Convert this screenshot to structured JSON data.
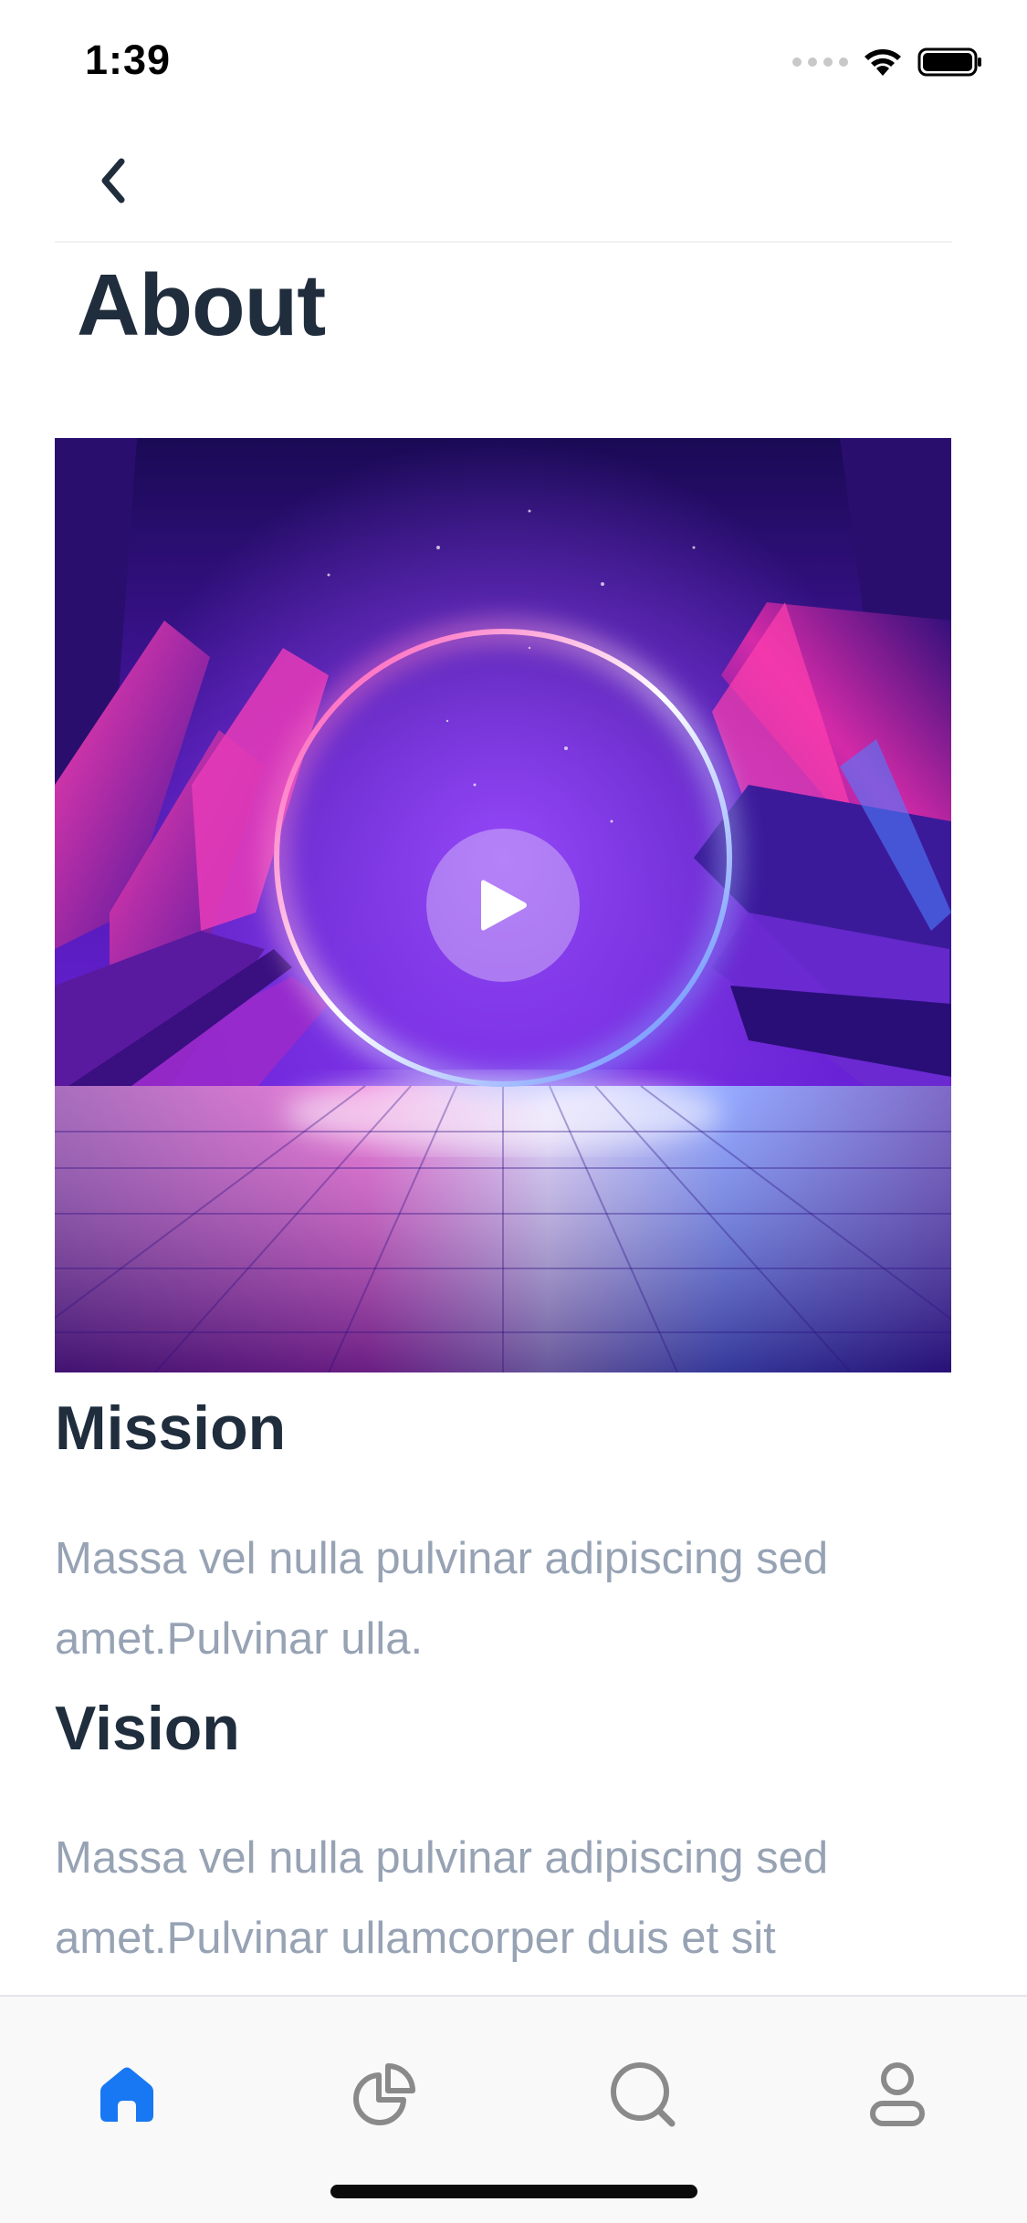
{
  "status_bar": {
    "time": "1:39"
  },
  "header": {
    "title": "About",
    "back_icon": "chevron-left-icon"
  },
  "media": {
    "play_icon": "play-icon"
  },
  "sections": [
    {
      "heading": "Mission",
      "body": "Massa vel nulla pulvinar adipiscing sed amet.Pulvinar ulla."
    },
    {
      "heading": "Vision",
      "body": "Massa vel nulla pulvinar adipiscing sed amet.Pulvinar ullamcorper duis et sit"
    }
  ],
  "tab_bar": {
    "tabs": [
      {
        "icon": "home-icon",
        "active": true
      },
      {
        "icon": "pie-chart-icon",
        "active": false
      },
      {
        "icon": "search-icon",
        "active": false
      },
      {
        "icon": "profile-icon",
        "active": false
      }
    ]
  },
  "colors": {
    "active_tab": "#1877f2",
    "inactive_tab": "#8a8a8a",
    "heading": "#1f2d3d",
    "body_text": "#97a3b4"
  }
}
